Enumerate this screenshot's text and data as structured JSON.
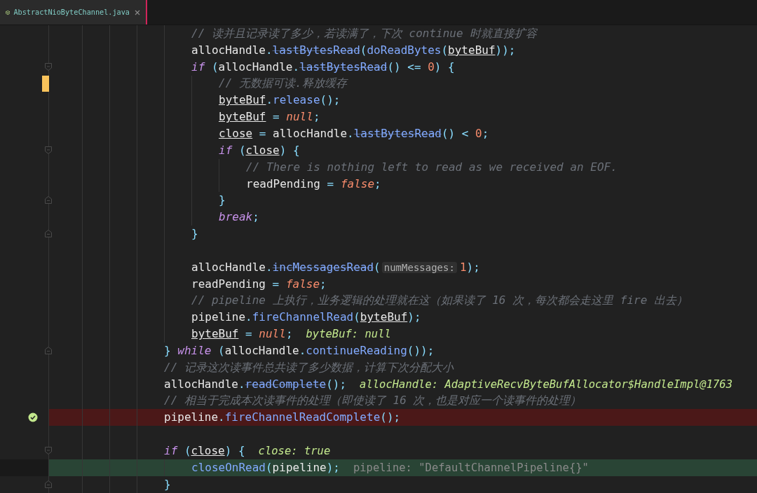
{
  "tab": {
    "label": "AbstractNioByteChannel.java",
    "selected": true
  },
  "code": [
    {
      "kind": "group",
      "children": [
        {
          "kind": "code",
          "tokens": [
            {
              "kind": "comment",
              "text": "// 读并且记录读了多少，若读满了，下次 continue 时就直接扩容"
            }
          ]
        },
        {
          "kind": "code",
          "tokens": [
            {
              "kind": "plain",
              "text": "allocHandle"
            },
            {
              "kind": "punct",
              "text": "."
            },
            {
              "kind": "deprecated",
              "text": "lastBytesRead"
            },
            {
              "kind": "punct",
              "text": "("
            },
            {
              "kind": "method",
              "text": "doReadBytes"
            },
            {
              "kind": "punct",
              "text": "("
            },
            {
              "kind": "var",
              "text": "byteBuf"
            },
            {
              "kind": "punct",
              "text": "));"
            }
          ]
        },
        {
          "kind": "code",
          "fold_start": true,
          "tokens": [
            {
              "kind": "keyword",
              "text": "if"
            },
            {
              "kind": "punct",
              "text": " ("
            },
            {
              "kind": "plain",
              "text": "allocHandle"
            },
            {
              "kind": "punct",
              "text": "."
            },
            {
              "kind": "deprecated",
              "text": "lastBytesRead"
            },
            {
              "kind": "punct",
              "text": "() <= "
            },
            {
              "kind": "number",
              "text": "0"
            },
            {
              "kind": "punct",
              "text": ") {"
            }
          ],
          "children": [
            {
              "kind": "code",
              "changed": true,
              "tokens": [
                {
                  "kind": "comment",
                  "text": "// 无数据可读.释放缓存"
                }
              ]
            },
            {
              "kind": "code",
              "tokens": [
                {
                  "kind": "var",
                  "text": "byteBuf"
                },
                {
                  "kind": "punct",
                  "text": "."
                },
                {
                  "kind": "method",
                  "text": "release"
                },
                {
                  "kind": "punct",
                  "text": "();"
                }
              ]
            },
            {
              "kind": "code",
              "tokens": [
                {
                  "kind": "var",
                  "text": "byteBuf"
                },
                {
                  "kind": "punct",
                  "text": " = "
                },
                {
                  "kind": "literal",
                  "text": "null"
                },
                {
                  "kind": "punct",
                  "text": ";"
                }
              ]
            },
            {
              "kind": "code",
              "tokens": [
                {
                  "kind": "var",
                  "text": "close"
                },
                {
                  "kind": "punct",
                  "text": " = "
                },
                {
                  "kind": "plain",
                  "text": "allocHandle"
                },
                {
                  "kind": "punct",
                  "text": "."
                },
                {
                  "kind": "deprecated",
                  "text": "lastBytesRead"
                },
                {
                  "kind": "punct",
                  "text": "() < "
                },
                {
                  "kind": "number",
                  "text": "0"
                },
                {
                  "kind": "punct",
                  "text": ";"
                }
              ]
            },
            {
              "kind": "code",
              "fold_start": true,
              "tokens": [
                {
                  "kind": "keyword",
                  "text": "if"
                },
                {
                  "kind": "punct",
                  "text": " ("
                },
                {
                  "kind": "var",
                  "text": "close"
                },
                {
                  "kind": "punct",
                  "text": ") {"
                }
              ],
              "children": [
                {
                  "kind": "code",
                  "tokens": [
                    {
                      "kind": "comment",
                      "text": "// There is nothing left to read as we received an EOF."
                    }
                  ]
                },
                {
                  "kind": "code",
                  "tokens": [
                    {
                      "kind": "plain",
                      "text": "readPending"
                    },
                    {
                      "kind": "punct",
                      "text": " = "
                    },
                    {
                      "kind": "literal",
                      "text": "false"
                    },
                    {
                      "kind": "punct",
                      "text": ";"
                    }
                  ]
                }
              ]
            },
            {
              "kind": "code",
              "fold_end": true,
              "tokens": [
                {
                  "kind": "punct",
                  "text": "}"
                }
              ]
            },
            {
              "kind": "code",
              "tokens": [
                {
                  "kind": "keyword",
                  "text": "break"
                },
                {
                  "kind": "punct",
                  "text": ";"
                }
              ]
            }
          ]
        },
        {
          "kind": "code",
          "fold_end": true,
          "tokens": [
            {
              "kind": "punct",
              "text": "}"
            }
          ]
        },
        {
          "kind": "blank"
        },
        {
          "kind": "code",
          "tokens": [
            {
              "kind": "plain",
              "text": "allocHandle"
            },
            {
              "kind": "punct",
              "text": "."
            },
            {
              "kind": "deprecated",
              "text": "incMessagesRead"
            },
            {
              "kind": "punct",
              "text": "("
            },
            {
              "kind": "hint",
              "text": "numMessages:"
            },
            {
              "kind": "number",
              "text": "1"
            },
            {
              "kind": "punct",
              "text": ");"
            }
          ]
        },
        {
          "kind": "code",
          "tokens": [
            {
              "kind": "plain",
              "text": "readPending"
            },
            {
              "kind": "punct",
              "text": " = "
            },
            {
              "kind": "literal",
              "text": "false"
            },
            {
              "kind": "punct",
              "text": ";"
            }
          ]
        },
        {
          "kind": "code",
          "tokens": [
            {
              "kind": "comment",
              "text": "// pipeline 上执行，业务逻辑的处理就在这（如果读了 16 次，每次都会走这里 fire 出去）"
            }
          ]
        },
        {
          "kind": "code",
          "tokens": [
            {
              "kind": "plain",
              "text": "pipeline"
            },
            {
              "kind": "punct",
              "text": "."
            },
            {
              "kind": "method",
              "text": "fireChannelRead"
            },
            {
              "kind": "punct",
              "text": "("
            },
            {
              "kind": "var",
              "text": "byteBuf"
            },
            {
              "kind": "punct",
              "text": ");"
            }
          ]
        },
        {
          "kind": "code",
          "tokens": [
            {
              "kind": "var",
              "text": "byteBuf"
            },
            {
              "kind": "punct",
              "text": " = "
            },
            {
              "kind": "literal",
              "text": "null"
            },
            {
              "kind": "punct",
              "text": ";"
            },
            {
              "kind": "value",
              "text": "byteBuf: null"
            }
          ]
        }
      ]
    },
    {
      "kind": "code",
      "fold_end": true,
      "tokens": [
        {
          "kind": "punct",
          "text": "} "
        },
        {
          "kind": "keyword",
          "text": "while"
        },
        {
          "kind": "punct",
          "text": " ("
        },
        {
          "kind": "plain",
          "text": "allocHandle"
        },
        {
          "kind": "punct",
          "text": "."
        },
        {
          "kind": "method",
          "text": "continueReading"
        },
        {
          "kind": "punct",
          "text": "());"
        }
      ]
    },
    {
      "kind": "code",
      "tokens": [
        {
          "kind": "comment",
          "text": "// 记录这次读事件总共读了多少数据，计算下次分配大小"
        }
      ]
    },
    {
      "kind": "code",
      "tokens": [
        {
          "kind": "plain",
          "text": "allocHandle"
        },
        {
          "kind": "punct",
          "text": "."
        },
        {
          "kind": "deprecated",
          "text": "readComplete"
        },
        {
          "kind": "punct",
          "text": "();"
        },
        {
          "kind": "value",
          "text": "allocHandle: AdaptiveRecvByteBufAllocator$HandleImpl@1763"
        }
      ]
    },
    {
      "kind": "code",
      "tokens": [
        {
          "kind": "comment",
          "text": "// 相当于完成本次读事件的处理（即使读了 16 次，也是对应一个读事件的处理）"
        }
      ]
    },
    {
      "kind": "code",
      "breakpoint": true,
      "tokens": [
        {
          "kind": "plain",
          "text": "pipeline"
        },
        {
          "kind": "punct",
          "text": "."
        },
        {
          "kind": "method",
          "text": "fireChannelReadComplete"
        },
        {
          "kind": "punct",
          "text": "();"
        }
      ]
    },
    {
      "kind": "blank"
    },
    {
      "kind": "code",
      "fold_start": true,
      "tokens": [
        {
          "kind": "keyword",
          "text": "if"
        },
        {
          "kind": "punct",
          "text": " ("
        },
        {
          "kind": "var",
          "text": "close"
        },
        {
          "kind": "punct",
          "text": ") {"
        },
        {
          "kind": "value",
          "text": "close: true"
        }
      ],
      "children": [
        {
          "kind": "code",
          "current": true,
          "tokens": [
            {
              "kind": "method",
              "text": "closeOnRead"
            },
            {
              "kind": "punct",
              "text": "("
            },
            {
              "kind": "plain",
              "text": "pipeline"
            },
            {
              "kind": "punct",
              "text": ");"
            },
            {
              "kind": "muted-value",
              "text": "pipeline: \"DefaultChannelPipeline{}\""
            }
          ]
        }
      ]
    },
    {
      "kind": "code",
      "fold_end": true,
      "tokens": [
        {
          "kind": "punct",
          "text": "}"
        }
      ]
    }
  ]
}
